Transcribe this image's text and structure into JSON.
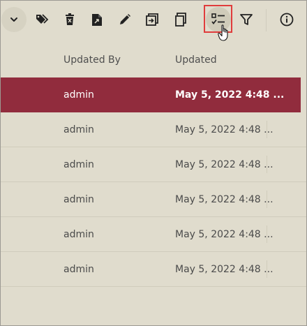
{
  "toolbar": {
    "buttons": [
      {
        "icon": "chevron-down-icon"
      },
      {
        "icon": "tags-icon"
      },
      {
        "icon": "delete-bin-icon"
      },
      {
        "icon": "export-file-icon"
      },
      {
        "icon": "edit-pencil-icon"
      },
      {
        "icon": "move-to-icon"
      },
      {
        "icon": "copy-icon"
      },
      {
        "icon": "checklist-icon",
        "active": true
      },
      {
        "icon": "filter-icon"
      },
      {
        "icon": "info-icon"
      }
    ]
  },
  "table": {
    "columns": [
      "Updated By",
      "Updated"
    ],
    "rows": [
      {
        "updated_by": "admin",
        "updated": "May 5, 2022 4:48 ...",
        "selected": true
      },
      {
        "updated_by": "admin",
        "updated": "May 5, 2022 4:48 ..."
      },
      {
        "updated_by": "admin",
        "updated": "May 5, 2022 4:48 ..."
      },
      {
        "updated_by": "admin",
        "updated": "May 5, 2022 4:48 ..."
      },
      {
        "updated_by": "admin",
        "updated": "May 5, 2022 4:48 ..."
      },
      {
        "updated_by": "admin",
        "updated": "May 5, 2022 4:48 ..."
      }
    ]
  },
  "colors": {
    "background": "#e0dccd",
    "selected_row": "#912c3d",
    "highlight": "#e03c3c",
    "icon": "#222222"
  }
}
